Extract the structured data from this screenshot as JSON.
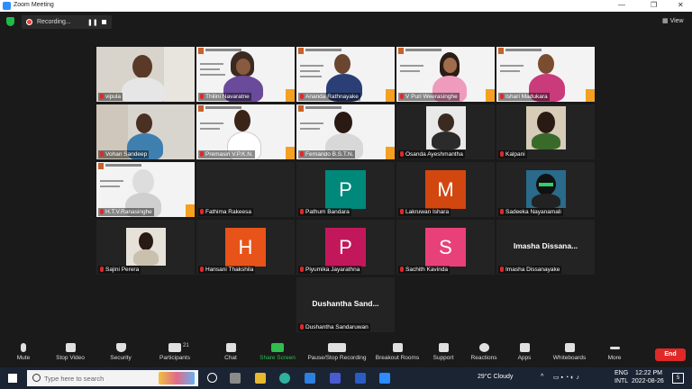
{
  "window": {
    "title": "Zoom Meeting"
  },
  "recording": {
    "status": "Recording..."
  },
  "view": {
    "label": "View"
  },
  "participants": [
    {
      "name": "vipula",
      "avatar_letter": "",
      "avatar_color": "",
      "kind": "camera"
    },
    {
      "name": "Thilini Navaratne",
      "avatar_letter": "",
      "avatar_color": "",
      "kind": "slide-person"
    },
    {
      "name": "Ananda Rathnayake",
      "avatar_letter": "",
      "avatar_color": "",
      "kind": "slide-person"
    },
    {
      "name": "V Puri Weerasinghe",
      "avatar_letter": "",
      "avatar_color": "",
      "kind": "slide-person"
    },
    {
      "name": "Ishari Madukara",
      "avatar_letter": "",
      "avatar_color": "",
      "kind": "slide-person"
    },
    {
      "name": "Vohan Sandeep",
      "avatar_letter": "",
      "avatar_color": "",
      "kind": "camera"
    },
    {
      "name": "Premasiri V.P.K.N.",
      "avatar_letter": "",
      "avatar_color": "",
      "kind": "slide-person"
    },
    {
      "name": "Fernando B.S.T.N.",
      "avatar_letter": "",
      "avatar_color": "",
      "kind": "slide-person"
    },
    {
      "name": "Osanda Ayeshmantha",
      "avatar_letter": "",
      "avatar_color": "",
      "kind": "photo"
    },
    {
      "name": "Kalpani",
      "avatar_letter": "",
      "avatar_color": "",
      "kind": "photo"
    },
    {
      "name": "H.T.V.Ranasinghe",
      "avatar_letter": "",
      "avatar_color": "",
      "kind": "slide-person"
    },
    {
      "name": "Fathima Rakeesa",
      "avatar_letter": "",
      "avatar_color": "",
      "kind": "blank"
    },
    {
      "name": "Pathum Bandara",
      "avatar_letter": "P",
      "avatar_color": "#00897b",
      "kind": "letter"
    },
    {
      "name": "Lakruwan Ishara",
      "avatar_letter": "M",
      "avatar_color": "#d1470f",
      "kind": "letter"
    },
    {
      "name": "Sadeeka Nayanamali",
      "avatar_letter": "",
      "avatar_color": "",
      "kind": "photo-helmet"
    },
    {
      "name": "Sajini Perera",
      "avatar_letter": "",
      "avatar_color": "",
      "kind": "photo-small"
    },
    {
      "name": "Hansani Thakshila",
      "avatar_letter": "H",
      "avatar_color": "#e8531a",
      "kind": "letter"
    },
    {
      "name": "Piyumika Jayarathna",
      "avatar_letter": "P",
      "avatar_color": "#c2185b",
      "kind": "letter"
    },
    {
      "name": "Sachith Kavinda",
      "avatar_letter": "S",
      "avatar_color": "#e8417a",
      "kind": "letter"
    },
    {
      "name": "Imasha Dissanayake",
      "display_text": "Imasha Dissana...",
      "avatar_letter": "",
      "avatar_color": "",
      "kind": "text"
    },
    {
      "name": "Dushantha Sandaruwan",
      "display_text": "Dushantha Sand...",
      "avatar_letter": "",
      "avatar_color": "",
      "kind": "text"
    }
  ],
  "toolbar": {
    "mute": "Mute",
    "stop_video": "Stop Video",
    "security": "Security",
    "participants": "Participants",
    "participants_count": "21",
    "chat": "Chat",
    "share_screen": "Share Screen",
    "pause_stop_recording": "Pause/Stop Recording",
    "breakout_rooms": "Breakout Rooms",
    "support": "Support",
    "reactions": "Reactions",
    "apps": "Apps",
    "whiteboards": "Whiteboards",
    "more": "More",
    "end": "End"
  },
  "taskbar": {
    "search_placeholder": "Type here to search",
    "weather": "29°C  Cloudy",
    "lang": "ENG",
    "lang2": "INTL",
    "time": "12:22 PM",
    "date": "2022-08-26",
    "notif_count": "5"
  },
  "colors": {
    "accent_green": "#2fbd4f",
    "end_red": "#e02828",
    "active_speaker": "#c8e34a"
  }
}
